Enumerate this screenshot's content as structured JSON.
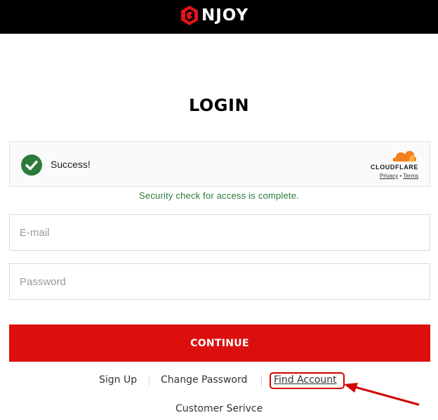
{
  "header": {
    "logo_text": "NJOY",
    "logo_icon": "njoy-logo-mark",
    "background": "#000000"
  },
  "title": "LOGIN",
  "captcha": {
    "status": "Success!",
    "provider": "CLOUDFLARE",
    "privacy_label": "Privacy",
    "separator": "•",
    "terms_label": "Terms",
    "check_icon": "checkmark-circle-icon",
    "check_color": "#2c7a3a"
  },
  "security_message": "Security check for access is complete.",
  "form": {
    "email_placeholder": "E-mail",
    "password_placeholder": "Password",
    "continue_label": "CONTINUE",
    "continue_color": "#dc0f0f"
  },
  "links": {
    "sign_up": "Sign Up",
    "change_password": "Change Password",
    "find_account": "Find Account",
    "customer_service": "Customer Serivce"
  },
  "annotation": {
    "highlight_color": "#d40000"
  }
}
